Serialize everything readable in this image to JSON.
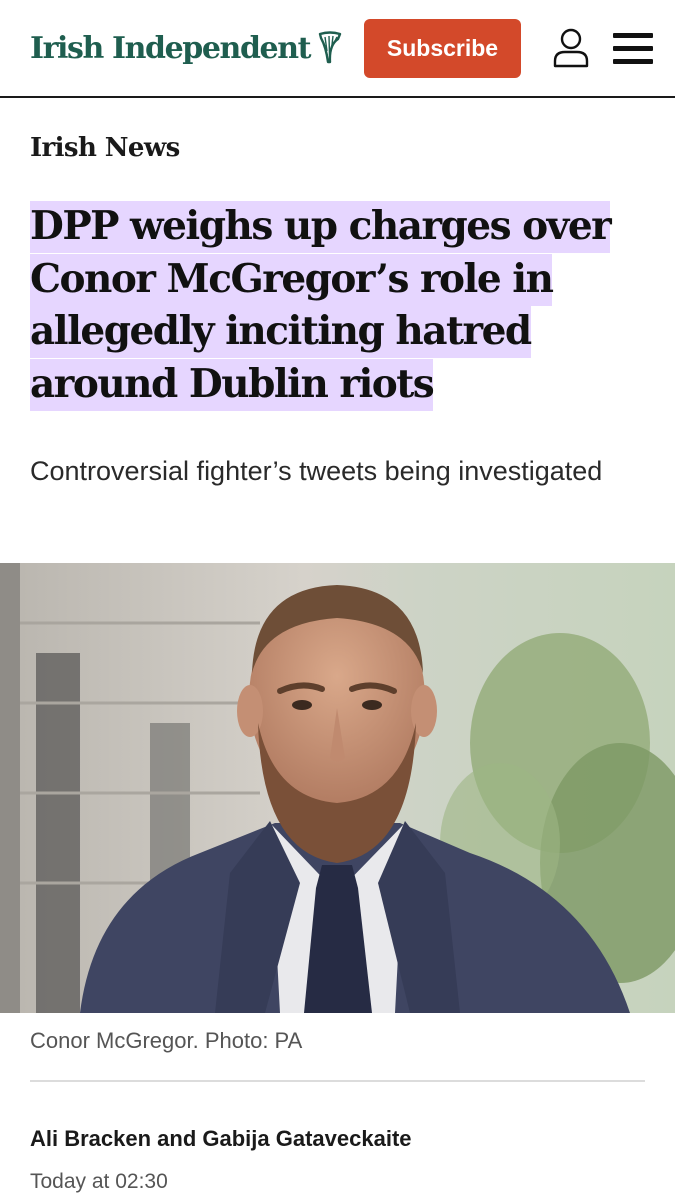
{
  "header": {
    "logo_text": "Irish Independent",
    "subscribe_label": "Subscribe",
    "icons": {
      "logo": "harp-icon",
      "account": "user-icon",
      "menu": "hamburger-menu-icon"
    }
  },
  "article": {
    "section": "Irish News",
    "headline": "DPP weighs up charges over Conor McGregor’s role in allegedly inciting hatred around Dublin riots",
    "standfirst": "Controversial fighter’s tweets being investigated",
    "photo_caption": "Conor McGregor. Photo: PA",
    "byline": "Ali Bracken and Gabija Gataveckaite",
    "published": "Today at 02:30"
  },
  "colors": {
    "brand_green": "#1f5e4f",
    "subscribe_red": "#d3492a",
    "headline_highlight": "#e6d6ff"
  }
}
